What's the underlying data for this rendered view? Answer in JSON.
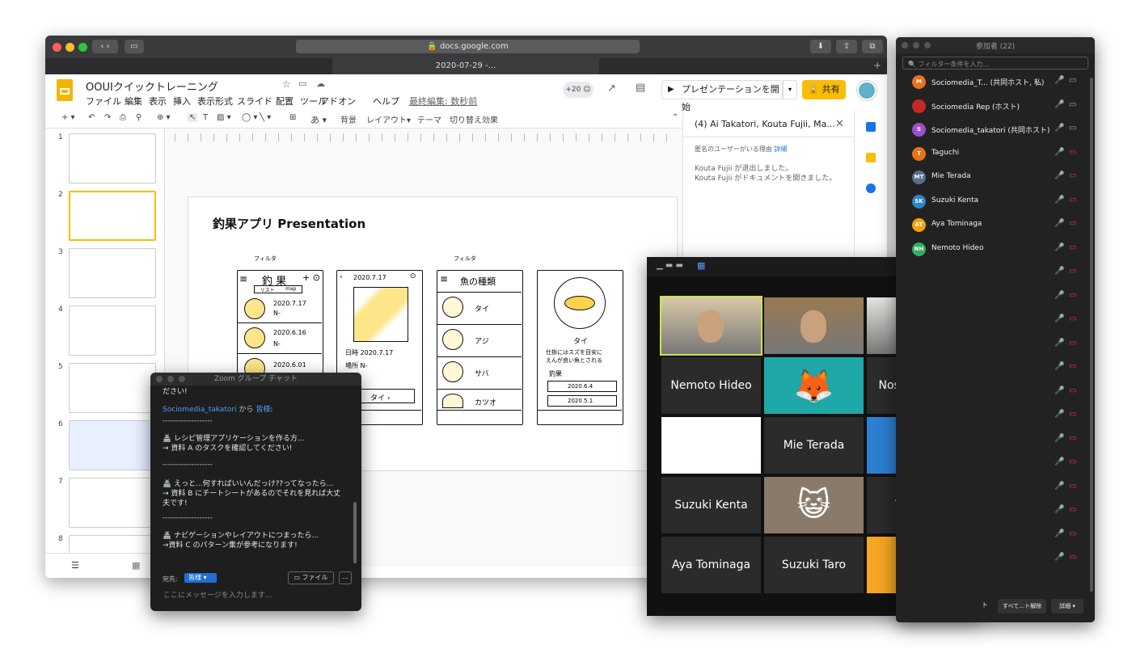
{
  "browser": {
    "url": "docs.google.com",
    "tab_title": "2020-07-29 -..."
  },
  "slides": {
    "doc_title": "OOUIクイックトレーニング",
    "menu": [
      "ファイル",
      "編集",
      "表示",
      "挿入",
      "表示形式",
      "スライド",
      "配置",
      "ツール",
      "アドオン",
      "ヘルプ"
    ],
    "last_edit": "最終編集: 数秒前",
    "collab_count": "+20",
    "present_label": "プレゼンテーションを開始",
    "share_label": "共有",
    "toolbar": {
      "background": "背景",
      "layout": "レイアウト▾",
      "theme": "テーマ",
      "transition": "切り替え効果"
    },
    "slide_numbers": [
      "1",
      "2",
      "3",
      "4",
      "5",
      "6",
      "7",
      "8"
    ],
    "slide_title": "釣果アプリ Presentation",
    "sketch": {
      "card1": {
        "filter": "フィルタ",
        "title": "釣 果",
        "tabs": [
          "リスト",
          "map"
        ],
        "dates": [
          "2020.7.17",
          "2020.6.16",
          "2020.6.01"
        ],
        "rows": [
          "N-",
          "N-"
        ]
      },
      "card2": {
        "date": "2020.7.17",
        "time": "日時 2020.7.17",
        "place": "場所 N-",
        "fish": "タイ"
      },
      "card3": {
        "filter": "フィルタ",
        "title": "魚の種類",
        "fish": [
          "タイ",
          "アジ",
          "サバ",
          "カツオ"
        ]
      },
      "card4": {
        "title": "タイ",
        "note": "仕掛にはスズを目安に\nえんが良い魚とされる",
        "log": "釣果",
        "dates": [
          "2020.6.4",
          "2020.5.1"
        ]
      }
    },
    "comment_panel": {
      "title": "(4) Ai Takatori, Kouta Fujii, Ma...",
      "anon_reason": "匿名のユーザーがいる理由",
      "detail_link": "詳細",
      "log": [
        "Kouta Fujii が退出しました。",
        "Kouta Fujii がドキュメントを開きました。"
      ]
    }
  },
  "chat": {
    "title": "Zoom グループ チャット",
    "partial_top": "ださい!",
    "sender": "Sociomedia_takatori",
    "from_word": "から",
    "recipient": "皆様",
    "divider": "-------------------",
    "lines": [
      "🏯 レシピ管理アプリケーションを作る方...",
      "→ 資料 A のタスクを確認してください!",
      "🏯 えっと...何すればいいんだっけ??ってなったら...",
      "→ 資料 B にチートシートがあるのでそれを見れば大丈夫です!",
      "🏯 ナビゲーションやレイアウトにつまったら...",
      "→資料 C のパターン集が参考になります!"
    ],
    "to_label": "宛先:",
    "to_value": "皆様",
    "file_button": "ファイル",
    "more_button": "...",
    "input_placeholder": "ここにメッセージを入力します..."
  },
  "gallery": {
    "tiles": [
      {
        "name": "",
        "kind": "video",
        "bg": "#d9c8a8"
      },
      {
        "name": "",
        "kind": "video",
        "bg": "#9a7a52"
      },
      {
        "name": "",
        "kind": "video",
        "bg": "#e4e4e0"
      },
      {
        "name": "Nemoto Hideo",
        "kind": "name"
      },
      {
        "name": "",
        "kind": "fox"
      },
      {
        "name": "NosakaUsuke",
        "kind": "name"
      },
      {
        "name": "",
        "kind": "cat"
      },
      {
        "name": "Mie Terada",
        "kind": "name"
      },
      {
        "name": "",
        "kind": "donut"
      },
      {
        "name": "Suzuki Kenta",
        "kind": "name"
      },
      {
        "name": "",
        "kind": "kitten"
      },
      {
        "name": "Taguchi",
        "kind": "name"
      },
      {
        "name": "Aya Tominaga",
        "kind": "name"
      },
      {
        "name": "Suzuki Taro",
        "kind": "name"
      },
      {
        "name": "",
        "kind": "duck"
      }
    ]
  },
  "participants": {
    "title": "参加者 (22)",
    "filter_placeholder": "フィルター条件を入力...",
    "list": [
      {
        "initials": "M",
        "name": "Sociomedia_T... (共同ホスト, 私)",
        "color": "#e8711a",
        "muted": false
      },
      {
        "initials": "",
        "name": "Sociomedia Rep (ホスト)",
        "color": "#c62828",
        "muted": false
      },
      {
        "initials": "S",
        "name": "Sociomedia_takatori (共同ホスト)",
        "color": "#9c4dcc",
        "muted": false
      },
      {
        "initials": "T",
        "name": "Taguchi",
        "color": "#e8711a",
        "muted": true
      },
      {
        "initials": "MT",
        "name": "Mie Terada",
        "color": "#5a6e8c",
        "muted": true
      },
      {
        "initials": "SK",
        "name": "Suzuki Kenta",
        "color": "#2a86c6",
        "muted": true
      },
      {
        "initials": "AT",
        "name": "Aya Tominaga",
        "color": "#f0a30a",
        "muted": true
      },
      {
        "initials": "NH",
        "name": "Nemoto Hideo",
        "color": "#2fae60",
        "muted": true
      }
    ],
    "more_rows": 14,
    "footer_buttons": [
      "ト",
      "すべて…ト解除",
      "詳細"
    ]
  }
}
